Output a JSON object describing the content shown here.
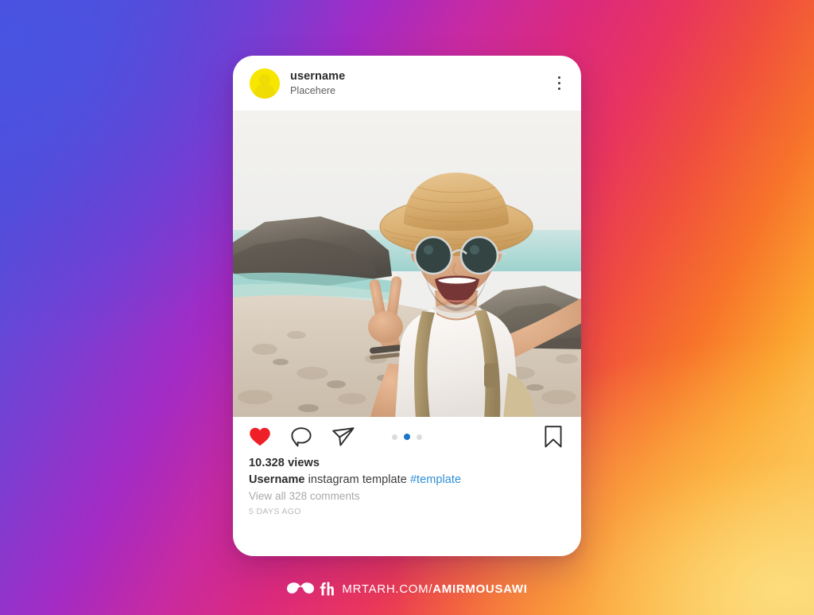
{
  "background": {
    "type": "instagram-brand-gradient",
    "colors": [
      "#4b52dc",
      "#7a3ed2",
      "#a32bc4",
      "#dd2a7b",
      "#f04e3e",
      "#f98a24",
      "#fbdd7e"
    ]
  },
  "post": {
    "header": {
      "avatar_color": "#f7e600",
      "username": "username",
      "subtitle": "Placehere",
      "more_menu_label": "⋮"
    },
    "photo": {
      "alt": "Man in straw hat and round sunglasses taking a selfie at a rocky beach, making a peace sign, wearing a white t-shirt and tan backpack"
    },
    "actions": {
      "like_label": "Like",
      "like_color": "#ee1f27",
      "comment_label": "Comment",
      "share_label": "Share",
      "save_label": "Save",
      "carousel": {
        "count": 3,
        "active_index": 1,
        "active_color": "#1876c8",
        "inactive_color": "#dcdcdc"
      }
    },
    "caption": {
      "views": "10.328 views",
      "author": "Username",
      "text": "instagram template",
      "hashtag": "#template",
      "hashtag_color": "#2f8fd6",
      "view_comments": "View all 328 comments",
      "timestamp": "5 DAYS AGO"
    }
  },
  "footer": {
    "logo_name": "mustache-logo",
    "monogram": "fh",
    "site": "MRTARH.COM/",
    "handle": "AMIRMOUSAWI"
  }
}
